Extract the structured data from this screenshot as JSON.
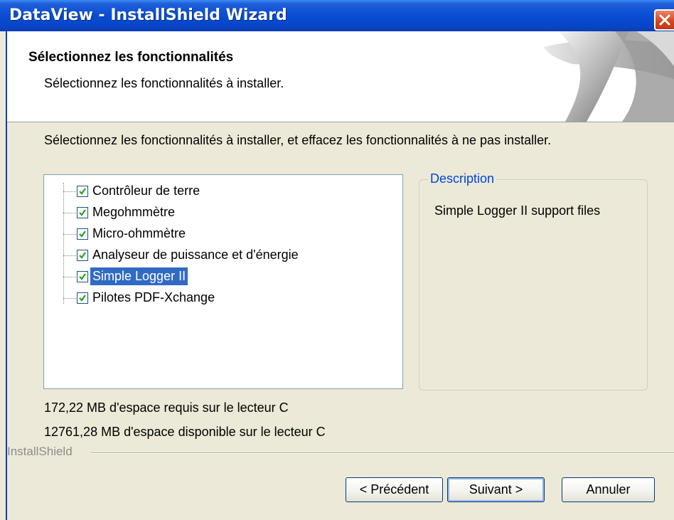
{
  "window": {
    "title": "DataView - InstallShield Wizard"
  },
  "header": {
    "title": "Sélectionnez les fonctionnalités",
    "subtitle": "Sélectionnez les fonctionnalités à installer."
  },
  "instruction": "Sélectionnez les fonctionnalités à installer, et effacez les fonctionnalités à ne pas installer.",
  "features": [
    {
      "label": "Contrôleur de terre",
      "checked": true,
      "selected": false
    },
    {
      "label": "Megohmmètre",
      "checked": true,
      "selected": false
    },
    {
      "label": "Micro-ohmmètre",
      "checked": true,
      "selected": false
    },
    {
      "label": "Analyseur de puissance et d'énergie",
      "checked": true,
      "selected": false
    },
    {
      "label": "Simple Logger II",
      "checked": true,
      "selected": true
    },
    {
      "label": "Pilotes PDF-Xchange",
      "checked": true,
      "selected": false
    }
  ],
  "description": {
    "legend": "Description",
    "text": "Simple Logger II support files"
  },
  "space": {
    "required": "172,22 MB d'espace requis sur le lecteur C",
    "available": "12761,28 MB d'espace disponible sur le lecteur C"
  },
  "footer_brand": "InstallShield",
  "buttons": {
    "back": "< Précédent",
    "next": "Suivant >",
    "cancel": "Annuler"
  },
  "colors": {
    "titlebar": "#0a4fd3",
    "selection": "#316ac5",
    "legend": "#0046d5",
    "dialog_bg": "#ece9d8"
  },
  "icons": {
    "close": "close-icon",
    "checkbox": "checkmark-icon",
    "header_art": "decorative-swoosh"
  }
}
